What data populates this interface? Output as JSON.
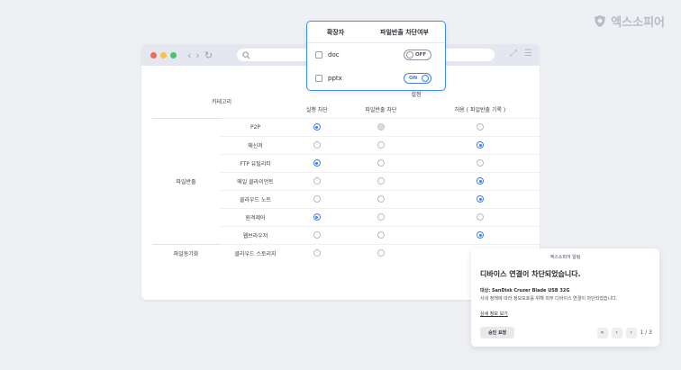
{
  "brand": {
    "name": "엑스소피어"
  },
  "browser": {
    "url_placeholder": "",
    "nav_back": "‹",
    "nav_forward": "›",
    "reload": "↻"
  },
  "table": {
    "category_header": "카테고리",
    "settings_header": "설정",
    "columns": [
      "실행 차단",
      "파일반출 차단",
      "허용 ( 파일반출 기록 )"
    ],
    "groups": [
      {
        "label": "파일반출",
        "rows": [
          {
            "category": "P2P",
            "selected": 0,
            "disabled_col": 1
          },
          {
            "category": "메신저",
            "selected": 2
          },
          {
            "category": "FTP 유틸리티",
            "selected": 0
          },
          {
            "category": "메일 클라이언트",
            "selected": 2
          },
          {
            "category": "클라우드 노트",
            "selected": 2
          },
          {
            "category": "원격제어",
            "selected": 0
          },
          {
            "category": "웹브라우저",
            "selected": 2
          }
        ]
      },
      {
        "label": "파일동기화",
        "rows": [
          {
            "category": "클라우드 스토리지",
            "selected": -1
          }
        ]
      }
    ]
  },
  "extension_popup": {
    "col_extension": "확장자",
    "col_block": "파일반출 차단여부",
    "rows": [
      {
        "ext": "doc",
        "state": "OFF"
      },
      {
        "ext": "pptx",
        "state": "ON"
      }
    ]
  },
  "notification": {
    "title": "엑스소피어 알림",
    "heading": "디바이스 연결이 차단되었습니다.",
    "target": "대상: SanDisk Cruzer Blade USB 32G",
    "message": "사내 정책에 따라 정보보호를 위해 외부 디바이스 연결이 차단되었습니다.",
    "details_link": "상세 정보 보기",
    "approve_button": "승인 요청",
    "pager_first": "«",
    "pager_prev": "‹",
    "pager_next": "›",
    "page_indicator": "1 / 3"
  }
}
